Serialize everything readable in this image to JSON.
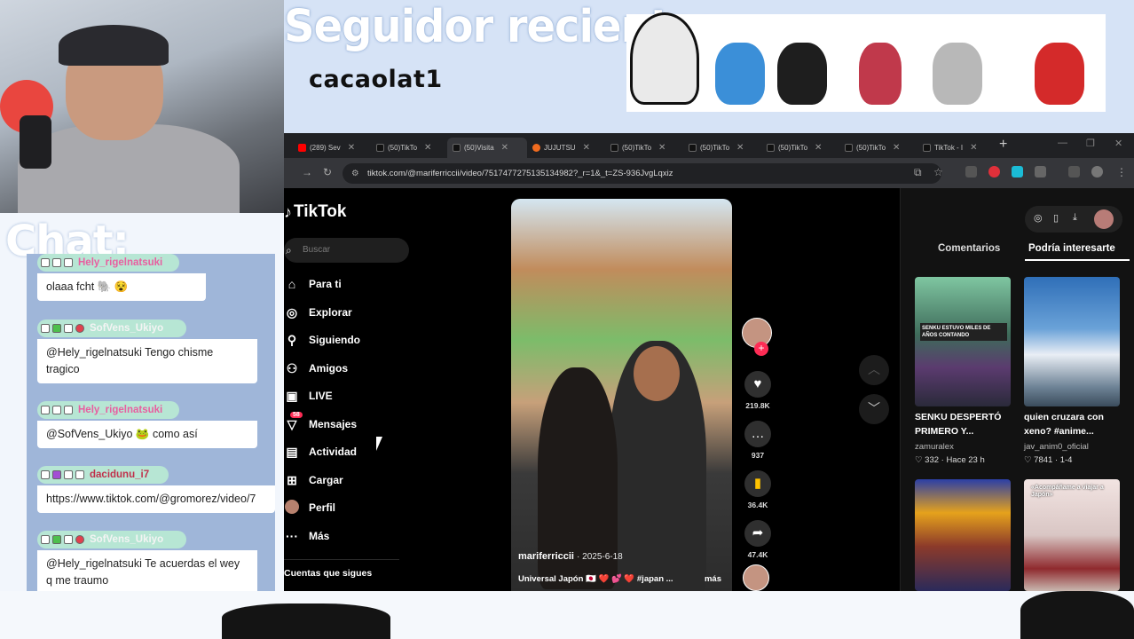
{
  "overlay": {
    "banner_title": "Seguidor reciente:",
    "banner_name": "cacaolat1",
    "chat_title": "Chat:"
  },
  "chat": {
    "messages": [
      {
        "user": "Hely_rigelnatsuki",
        "user_color": "#e85fa0",
        "text": "olaaa fcht 🐘 😵"
      },
      {
        "user": "SofVens_Ukiyo",
        "user_color": "#f4f4f4",
        "text": "@Hely_rigelnatsuki Tengo chisme tragico"
      },
      {
        "user": "Hely_rigelnatsuki",
        "user_color": "#e85fa0",
        "text": "@SofVens_Ukiyo 🐸 como así"
      },
      {
        "user": "dacidunu_i7",
        "user_color": "#c0304a",
        "text": "https://www.tiktok.com/@gromorez/video/7"
      },
      {
        "user": "SofVens_Ukiyo",
        "user_color": "#f4f4f4",
        "text": "@Hely_rigelnatsuki Te acuerdas el wey q me traumo"
      }
    ]
  },
  "browser": {
    "tabs": [
      {
        "label": "(289) Sev",
        "icon": "youtube-icon"
      },
      {
        "label": "(50)TikTo",
        "icon": "tiktok-icon"
      },
      {
        "label": "(50)Visita",
        "icon": "tiktok-icon"
      },
      {
        "label": "JUJUTSU",
        "icon": "crunchyroll-icon"
      },
      {
        "label": "(50)TikTo",
        "icon": "tiktok-icon"
      },
      {
        "label": "(50)TikTo",
        "icon": "tiktok-icon"
      },
      {
        "label": "(50)TikTo",
        "icon": "tiktok-icon"
      },
      {
        "label": "(50)TikTo",
        "icon": "tiktok-icon"
      },
      {
        "label": "TikTok - I",
        "icon": "tiktok-icon"
      }
    ],
    "active_tab": 2,
    "url": "tiktok.com/@mariferriccii/video/7517477275135134982?_r=1&_t=ZS-936JvgLqxiz"
  },
  "tiktok": {
    "logo": "TikTok",
    "search_placeholder": "Buscar",
    "nav": [
      {
        "label": "Para ti",
        "icon": "home-icon"
      },
      {
        "label": "Explorar",
        "icon": "compass-icon"
      },
      {
        "label": "Siguiendo",
        "icon": "following-icon"
      },
      {
        "label": "Amigos",
        "icon": "friends-icon"
      },
      {
        "label": "LIVE",
        "icon": "live-icon"
      },
      {
        "label": "Mensajes",
        "icon": "inbox-icon",
        "badge": "58"
      },
      {
        "label": "Actividad",
        "icon": "activity-icon"
      },
      {
        "label": "Cargar",
        "icon": "upload-icon"
      },
      {
        "label": "Perfil",
        "icon": "avatar"
      },
      {
        "label": "Más",
        "icon": "more-icon"
      }
    ],
    "following_label": "Cuentas que sigues",
    "video": {
      "username": "mariferriccii",
      "date": "· 2025-6-18",
      "description": "Universal Japón 🇯🇵 ❤️ 💕 ❤️ #japan ...",
      "more": "más"
    },
    "actions": {
      "likes": "219.8K",
      "comments": "937",
      "saves": "36.4K",
      "shares": "47.4K"
    },
    "right_tabs": {
      "comments": "Comentarios",
      "recommended": "Podría interesarte"
    },
    "recommended": [
      {
        "title": "SENKU DESPERTÓ PRIMERO Y...",
        "user": "zamuralex",
        "stats": "♡ 332 · Hace 23 h",
        "caption": "SENKU ESTUVO MILES DE AÑOS CONTANDO"
      },
      {
        "title": "quien cruzara con xeno? #anime...",
        "user": "jav_anim0_oficial",
        "stats": "♡ 7841 · 1-4"
      },
      {
        "title": "",
        "user": "",
        "stats": ""
      },
      {
        "title": "",
        "user": "",
        "stats": "",
        "caption": "«Acompáñame a viajar a Japón»"
      }
    ],
    "colors": {
      "accent": "#fe2c55",
      "save": "#ffc300"
    }
  }
}
